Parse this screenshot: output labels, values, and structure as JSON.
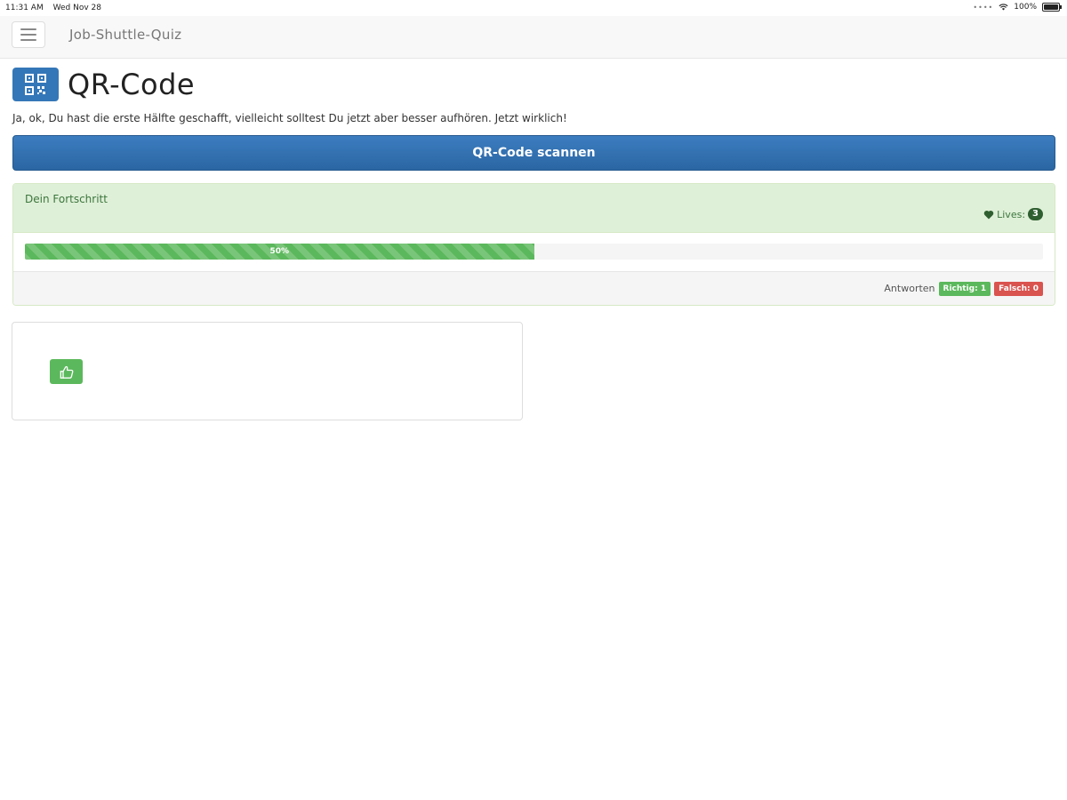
{
  "status_bar": {
    "time": "11:31 AM",
    "date": "Wed Nov 28",
    "battery": "100%",
    "wifi_icon": "wifi-icon"
  },
  "navbar": {
    "brand": "Job-Shuttle-Quiz",
    "menu_icon": "hamburger-icon"
  },
  "header": {
    "icon": "qr-code-icon",
    "title": "QR-Code",
    "subtitle": "Ja, ok, Du hast die erste Hälfte geschafft, vielleicht solltest Du jetzt aber besser aufhören. Jetzt wirklich!"
  },
  "scan_button": {
    "label": "QR-Code scannen",
    "color": "#337ab7"
  },
  "progress_panel": {
    "title": "Dein Fortschritt",
    "lives_icon": "heart-icon",
    "lives_label": "Lives:",
    "lives_count": "3",
    "progress_percent": 50,
    "progress_text": "50%",
    "answers_label": "Antworten",
    "correct_label": "Richtig: 1",
    "wrong_label": "Falsch: 0"
  },
  "result_card": {
    "icon": "thumbs-up-icon",
    "success_color": "#5cb85c"
  },
  "colors": {
    "primary": "#337ab7",
    "success": "#5cb85c",
    "danger": "#d9534f",
    "panel_success_bg": "#dff0d8"
  }
}
